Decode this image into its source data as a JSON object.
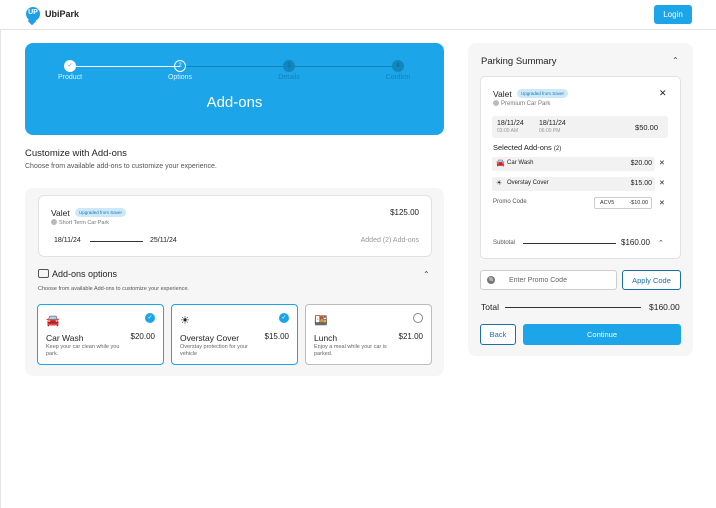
{
  "header": {
    "logo_letter": "UP",
    "brand": "UbiPark",
    "login_label": "Login"
  },
  "stepper": {
    "steps": [
      {
        "label": "Product",
        "num": "✓",
        "state": "done"
      },
      {
        "label": "Options",
        "num": "2",
        "state": "current"
      },
      {
        "label": "Details",
        "num": "3",
        "state": "future"
      },
      {
        "label": "Confirm",
        "num": "4",
        "state": "future"
      }
    ],
    "title": "Add-ons",
    "colors": {
      "accent": "#1ca5e8"
    }
  },
  "customize": {
    "title": "Customize with Add-ons",
    "subtitle": "Choose from available add-ons to customize your experience."
  },
  "booking": {
    "product": "Valet",
    "badge": "Upgraded from Saver",
    "location": "Short Term Car Park",
    "price": "$125.00",
    "start_date": "18/11/24",
    "end_date": "25/11/24",
    "added_text": "Added (2) Add-ons"
  },
  "addons": {
    "title": "Add-ons options",
    "subtitle": "Choose from available Add-ons to customize your experience.",
    "items": [
      {
        "name": "Car Wash",
        "price": "$20.00",
        "desc": "Keep your car clean while you park.",
        "selected": true,
        "icon": "car-wash-icon"
      },
      {
        "name": "Overstay Cover",
        "price": "$15.00",
        "desc": "Overstay protection for your vehicle",
        "selected": true,
        "icon": "shield-sun-icon"
      },
      {
        "name": "Lunch",
        "price": "$21.00",
        "desc": "Enjoy a meal while your car is parked.",
        "selected": false,
        "icon": "food-tray-icon"
      }
    ]
  },
  "summary": {
    "title": "Parking Summary",
    "product": "Valet",
    "badge": "Upgraded from Saver",
    "location": "Premium Car Park",
    "start_date": "18/11/24",
    "start_time": "03:00 AM",
    "end_date": "18/11/24",
    "end_time": "06:00 PM",
    "price": "$50.00",
    "selected_label": "Selected Add-ons",
    "selected_count": "(2)",
    "selected_items": [
      {
        "name": "Car Wash",
        "price": "$20.00"
      },
      {
        "name": "Overstay Cover",
        "price": "$15.00"
      }
    ],
    "promo_label": "Promo Code",
    "promo_code": "ACV5",
    "promo_discount": "-$10.00",
    "subtotal_label": "Subtotal",
    "subtotal": "$160.00"
  },
  "promo": {
    "placeholder": "Enter Promo Code",
    "apply_label": "Apply Code"
  },
  "total": {
    "label": "Total",
    "value": "$160.00"
  },
  "actions": {
    "back_label": "Back",
    "continue_label": "Continue"
  }
}
